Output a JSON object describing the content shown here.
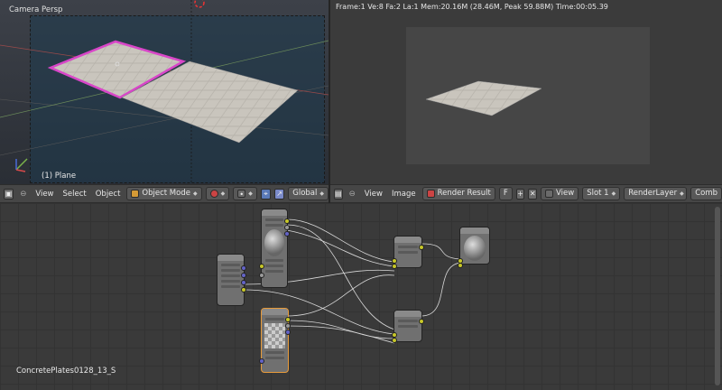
{
  "viewport3d": {
    "title": "Camera Persp",
    "object_label": "(1) Plane"
  },
  "image_editor": {
    "stats": "Frame:1 Ve:8 Fa:2 La:1 Mem:20.16M (28.46M, Peak 59.88M) Time:00:05.39"
  },
  "header_3d": {
    "view": "View",
    "select": "Select",
    "object": "Object",
    "mode": "Object Mode",
    "orientation": "Global"
  },
  "header_image": {
    "view": "View",
    "image": "Image",
    "image_name": "Render Result",
    "fake_user": "F",
    "view_dd": "View",
    "slot": "Slot 1",
    "layer": "RenderLayer",
    "pass": "Comb"
  },
  "node_editor": {
    "material_name": "ConcretePlates0128_13_S"
  },
  "colors": {
    "selection_outline": "#d846c8",
    "socket_yellow": "#c7c729",
    "socket_gray": "#9a9a9a",
    "socket_blue": "#6363c7"
  }
}
